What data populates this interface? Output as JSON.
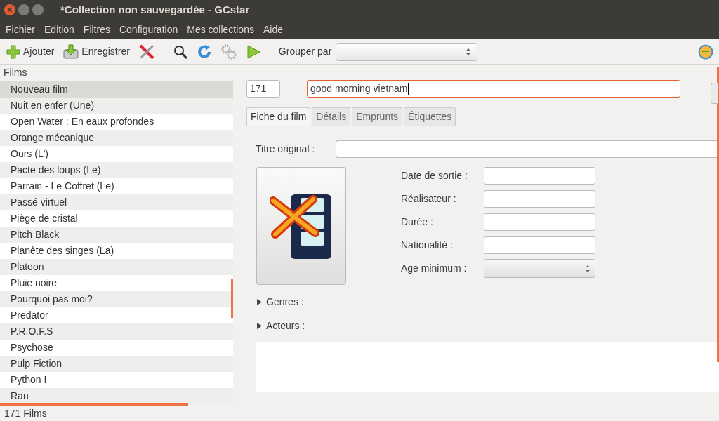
{
  "window": {
    "title": "*Collection non sauvegardée - GCstar"
  },
  "menu": [
    "Fichier",
    "Edition",
    "Filtres",
    "Configuration",
    "Mes collections",
    "Aide"
  ],
  "toolbar": {
    "add": "Ajouter",
    "save": "Enregistrer",
    "group_label": "Grouper par"
  },
  "list": {
    "header": "Films",
    "items": [
      {
        "label": "Nouveau film",
        "selected": true
      },
      {
        "label": "Nuit en enfer (Une)",
        "selected": false
      },
      {
        "label": "Open Water : En eaux profondes",
        "selected": false
      },
      {
        "label": "Orange mécanique",
        "selected": false
      },
      {
        "label": "Ours (L')",
        "selected": false
      },
      {
        "label": "Pacte des loups (Le)",
        "selected": false
      },
      {
        "label": "Parrain - Le Coffret (Le)",
        "selected": false
      },
      {
        "label": "Passé virtuel",
        "selected": false
      },
      {
        "label": "Piège de cristal",
        "selected": false
      },
      {
        "label": "Pitch Black",
        "selected": false
      },
      {
        "label": "Planète des singes (La)",
        "selected": false
      },
      {
        "label": "Platoon",
        "selected": false
      },
      {
        "label": "Pluie noire",
        "selected": false
      },
      {
        "label": "Pourquoi pas moi?",
        "selected": false
      },
      {
        "label": "Predator",
        "selected": false
      },
      {
        "label": "P.R.O.F.S",
        "selected": false
      },
      {
        "label": "Psychose",
        "selected": false
      },
      {
        "label": "Pulp Fiction",
        "selected": false
      },
      {
        "label": "Python I",
        "selected": false
      },
      {
        "label": "Ran",
        "selected": false
      }
    ]
  },
  "detail": {
    "id": "171",
    "title": "good morning vietnam",
    "tabs": [
      {
        "label": "Fiche du film",
        "selected": true
      },
      {
        "label": "Détails",
        "selected": false
      },
      {
        "label": "Emprunts",
        "selected": false
      },
      {
        "label": "Étiquettes",
        "selected": false
      }
    ],
    "original_title_label": "Titre original :",
    "fields": [
      {
        "label": "Date de sortie :",
        "kind": "text"
      },
      {
        "label": "Réalisateur :",
        "kind": "text"
      },
      {
        "label": "Durée :",
        "kind": "text"
      },
      {
        "label": "Nationalité :",
        "kind": "text"
      },
      {
        "label": "Age minimum :",
        "kind": "spin"
      }
    ],
    "sections": [
      {
        "label": "Genres :",
        "expanded": false
      },
      {
        "label": "Acteurs :",
        "expanded": false
      }
    ]
  },
  "status_bar": "171 Films"
}
